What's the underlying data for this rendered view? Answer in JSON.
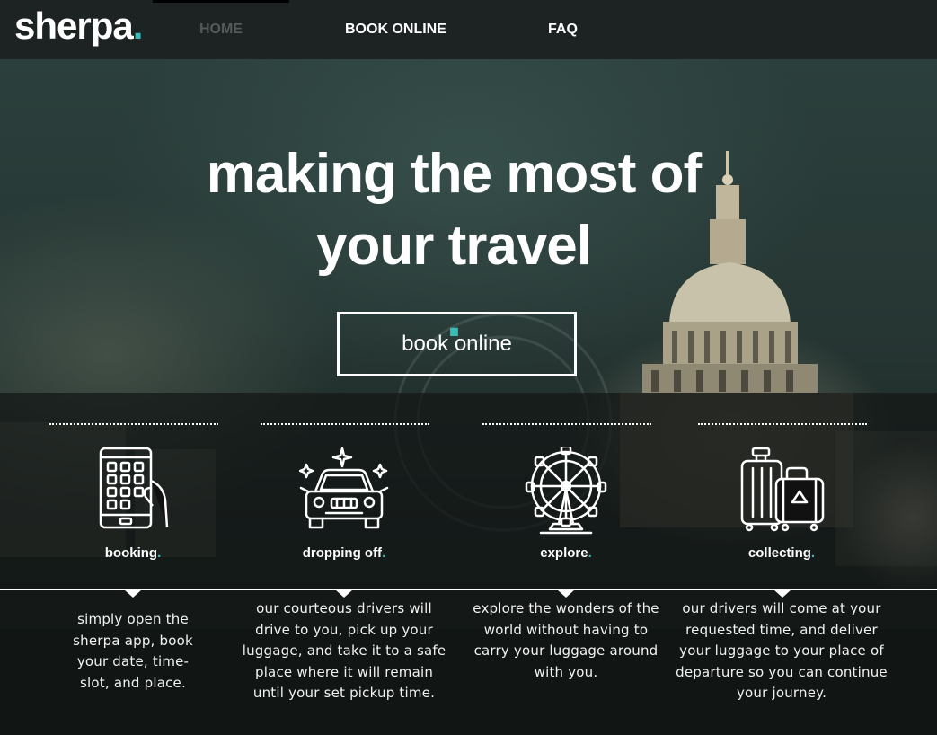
{
  "brand": {
    "name": "sherpa",
    "dot": ".",
    "accent_color": "#3bbdb7"
  },
  "nav": {
    "items": [
      {
        "label": "HOME",
        "state": "active"
      },
      {
        "label": "BOOK ONLINE",
        "state": "default"
      },
      {
        "label": "FAQ",
        "state": "default"
      }
    ]
  },
  "hero": {
    "headline_line1": "making the most of",
    "headline_line2": "your travel",
    "headline_dot": ".",
    "cta_label": "book online"
  },
  "features": [
    {
      "icon": "phone-keypad-hand-icon",
      "title": "booking",
      "dot": ".",
      "description": "simply open the sherpa app, book your date, time-slot, and place."
    },
    {
      "icon": "car-sparkle-icon",
      "title": "dropping off",
      "dot": ".",
      "description": "our courteous drivers will drive to you, pick up your luggage, and take it to a safe place where it will remain until your set pickup time."
    },
    {
      "icon": "ferris-wheel-icon",
      "title": "explore",
      "dot": ".",
      "description": "explore the wonders of the world without having to carry your luggage around with you."
    },
    {
      "icon": "luggage-icon",
      "title": "collecting",
      "dot": ".",
      "description": "our drivers will come at your requested time, and deliver your luggage to your place of departure so you can continue your journey."
    }
  ]
}
